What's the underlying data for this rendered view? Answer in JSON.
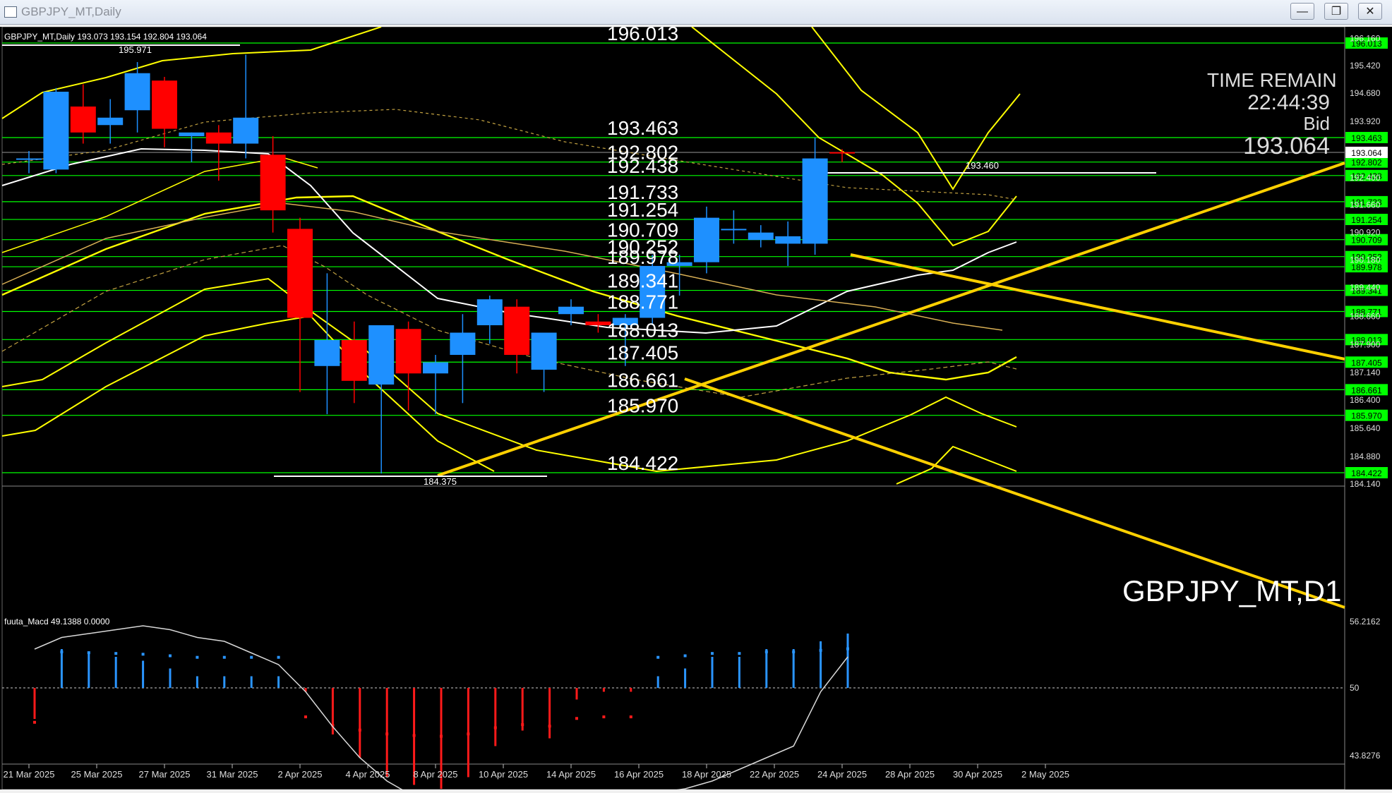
{
  "window": {
    "title": "GBPJPY_MT,Daily",
    "minimize": "—",
    "restore": "❐",
    "close": "✕"
  },
  "chart_info": {
    "symbol_line": "GBPJPY_MT,Daily  193.073 193.154 192.804 193.064",
    "high_label": "195.971",
    "low_label": "184.375",
    "last_high_label": "193.460",
    "watermark": "GBPJPY_MT,D1"
  },
  "time_remain": {
    "title": "TIME REMAIN",
    "time": "22:44:39",
    "bid_label": "Bid",
    "bid": "193.064"
  },
  "macd": {
    "label": "fuuta_Macd 49.1388  0.0000",
    "top": "56.2162",
    "mid": "50",
    "bottom": "43.8276"
  },
  "colors": {
    "bull": "#1e90ff",
    "bear": "#ff0000",
    "level": "#00ff00",
    "trend": "#ffd000",
    "band": "#ffff00"
  },
  "price_axis": [
    "196.160",
    "195.420",
    "194.680",
    "193.920",
    "192.400",
    "191.660",
    "190.920",
    "190.180",
    "189.440",
    "188.660",
    "187.900",
    "187.140",
    "186.400",
    "185.640",
    "184.880",
    "184.140"
  ],
  "levels": [
    {
      "label": "196.013",
      "price": 196.013
    },
    {
      "label": "193.463",
      "price": 193.463
    },
    {
      "label": "192.802",
      "price": 192.802
    },
    {
      "label": "192.438",
      "price": 192.438
    },
    {
      "label": "191.733",
      "price": 191.733
    },
    {
      "label": "191.254",
      "price": 191.254
    },
    {
      "label": "190.709",
      "price": 190.709
    },
    {
      "label": "190.252",
      "price": 190.252
    },
    {
      "label": "189.978",
      "price": 189.978
    },
    {
      "label": "189.341",
      "price": 189.341
    },
    {
      "label": "188.771",
      "price": 188.771
    },
    {
      "label": "188.013",
      "price": 188.013
    },
    {
      "label": "187.405",
      "price": 187.405
    },
    {
      "label": "186.661",
      "price": 186.661
    },
    {
      "label": "185.970",
      "price": 185.97
    },
    {
      "label": "184.422",
      "price": 184.422
    }
  ],
  "current_price": "193.064",
  "date_axis": [
    "21 Mar 2025",
    "25 Mar 2025",
    "27 Mar 2025",
    "31 Mar 2025",
    "2 Apr 2025",
    "4 Apr 2025",
    "8 Apr 2025",
    "10 Apr 2025",
    "14 Apr 2025",
    "16 Apr 2025",
    "18 Apr 2025",
    "22 Apr 2025",
    "24 Apr 2025",
    "28 Apr 2025",
    "30 Apr 2025",
    "2 May 2025"
  ],
  "candles": [
    {
      "o": 192.9,
      "h": 193.1,
      "l": 192.5,
      "c": 192.9
    },
    {
      "o": 192.6,
      "h": 194.8,
      "l": 192.5,
      "c": 194.7
    },
    {
      "o": 194.3,
      "h": 194.9,
      "l": 193.3,
      "c": 193.6
    },
    {
      "o": 193.8,
      "h": 194.5,
      "l": 193.3,
      "c": 194.0
    },
    {
      "o": 194.2,
      "h": 195.5,
      "l": 193.6,
      "c": 195.2
    },
    {
      "o": 195.0,
      "h": 195.1,
      "l": 193.2,
      "c": 193.7
    },
    {
      "o": 193.5,
      "h": 193.6,
      "l": 192.8,
      "c": 193.6
    },
    {
      "o": 193.6,
      "h": 193.8,
      "l": 192.3,
      "c": 193.3
    },
    {
      "o": 193.3,
      "h": 195.7,
      "l": 192.9,
      "c": 194.0
    },
    {
      "o": 193.0,
      "h": 193.5,
      "l": 190.9,
      "c": 191.5
    },
    {
      "o": 191.0,
      "h": 191.3,
      "l": 186.6,
      "c": 188.6
    },
    {
      "o": 187.3,
      "h": 189.8,
      "l": 186.0,
      "c": 188.0
    },
    {
      "o": 188.0,
      "h": 188.5,
      "l": 186.3,
      "c": 186.9
    },
    {
      "o": 186.8,
      "h": 188.0,
      "l": 184.4,
      "c": 188.4
    },
    {
      "o": 188.3,
      "h": 188.5,
      "l": 186.1,
      "c": 187.1
    },
    {
      "o": 187.1,
      "h": 187.6,
      "l": 186.0,
      "c": 187.4
    },
    {
      "o": 187.6,
      "h": 188.7,
      "l": 186.3,
      "c": 188.2
    },
    {
      "o": 188.4,
      "h": 189.2,
      "l": 187.9,
      "c": 189.1
    },
    {
      "o": 188.9,
      "h": 189.1,
      "l": 187.1,
      "c": 187.6
    },
    {
      "o": 187.2,
      "h": 188.2,
      "l": 186.6,
      "c": 188.2
    },
    {
      "o": 188.7,
      "h": 189.1,
      "l": 188.4,
      "c": 188.9
    },
    {
      "o": 188.5,
      "h": 188.7,
      "l": 188.2,
      "c": 188.4
    },
    {
      "o": 188.4,
      "h": 188.7,
      "l": 187.3,
      "c": 188.6
    },
    {
      "o": 188.6,
      "h": 190.3,
      "l": 188.4,
      "c": 190.0
    },
    {
      "o": 190.0,
      "h": 190.3,
      "l": 189.2,
      "c": 190.1
    },
    {
      "o": 190.1,
      "h": 191.6,
      "l": 189.8,
      "c": 191.3
    },
    {
      "o": 191.0,
      "h": 191.5,
      "l": 190.6,
      "c": 191.0
    },
    {
      "o": 190.7,
      "h": 191.1,
      "l": 190.5,
      "c": 190.9
    },
    {
      "o": 190.6,
      "h": 191.2,
      "l": 190.0,
      "c": 190.8
    },
    {
      "o": 190.6,
      "h": 193.46,
      "l": 190.3,
      "c": 192.9
    },
    {
      "o": 193.07,
      "h": 193.15,
      "l": 192.8,
      "c": 193.06
    }
  ],
  "macd_hist": [
    -0.8,
    1.0,
    0.9,
    0.8,
    0.7,
    0.5,
    0.3,
    0.3,
    0.3,
    0.3,
    -0.1,
    -1.2,
    -1.8,
    -2.3,
    -2.5,
    -2.6,
    -2.3,
    -1.5,
    -1.1,
    -1.3,
    -0.3,
    -0.1,
    -0.1,
    0.3,
    0.5,
    0.8,
    0.8,
    1.0,
    1.0,
    1.2,
    1.4
  ],
  "macd_signal": [
    1.0,
    1.3,
    1.4,
    1.5,
    1.6,
    1.5,
    1.3,
    1.2,
    0.9,
    0.6,
    -0.1,
    -1.0,
    -1.8,
    -2.4,
    -2.8,
    -3.0,
    -3.0,
    -2.8,
    -2.8,
    -2.9,
    -2.9,
    -2.8,
    -2.8,
    -2.7,
    -2.6,
    -2.4,
    -2.1,
    -1.8,
    -1.5,
    -0.1,
    0.8
  ]
}
